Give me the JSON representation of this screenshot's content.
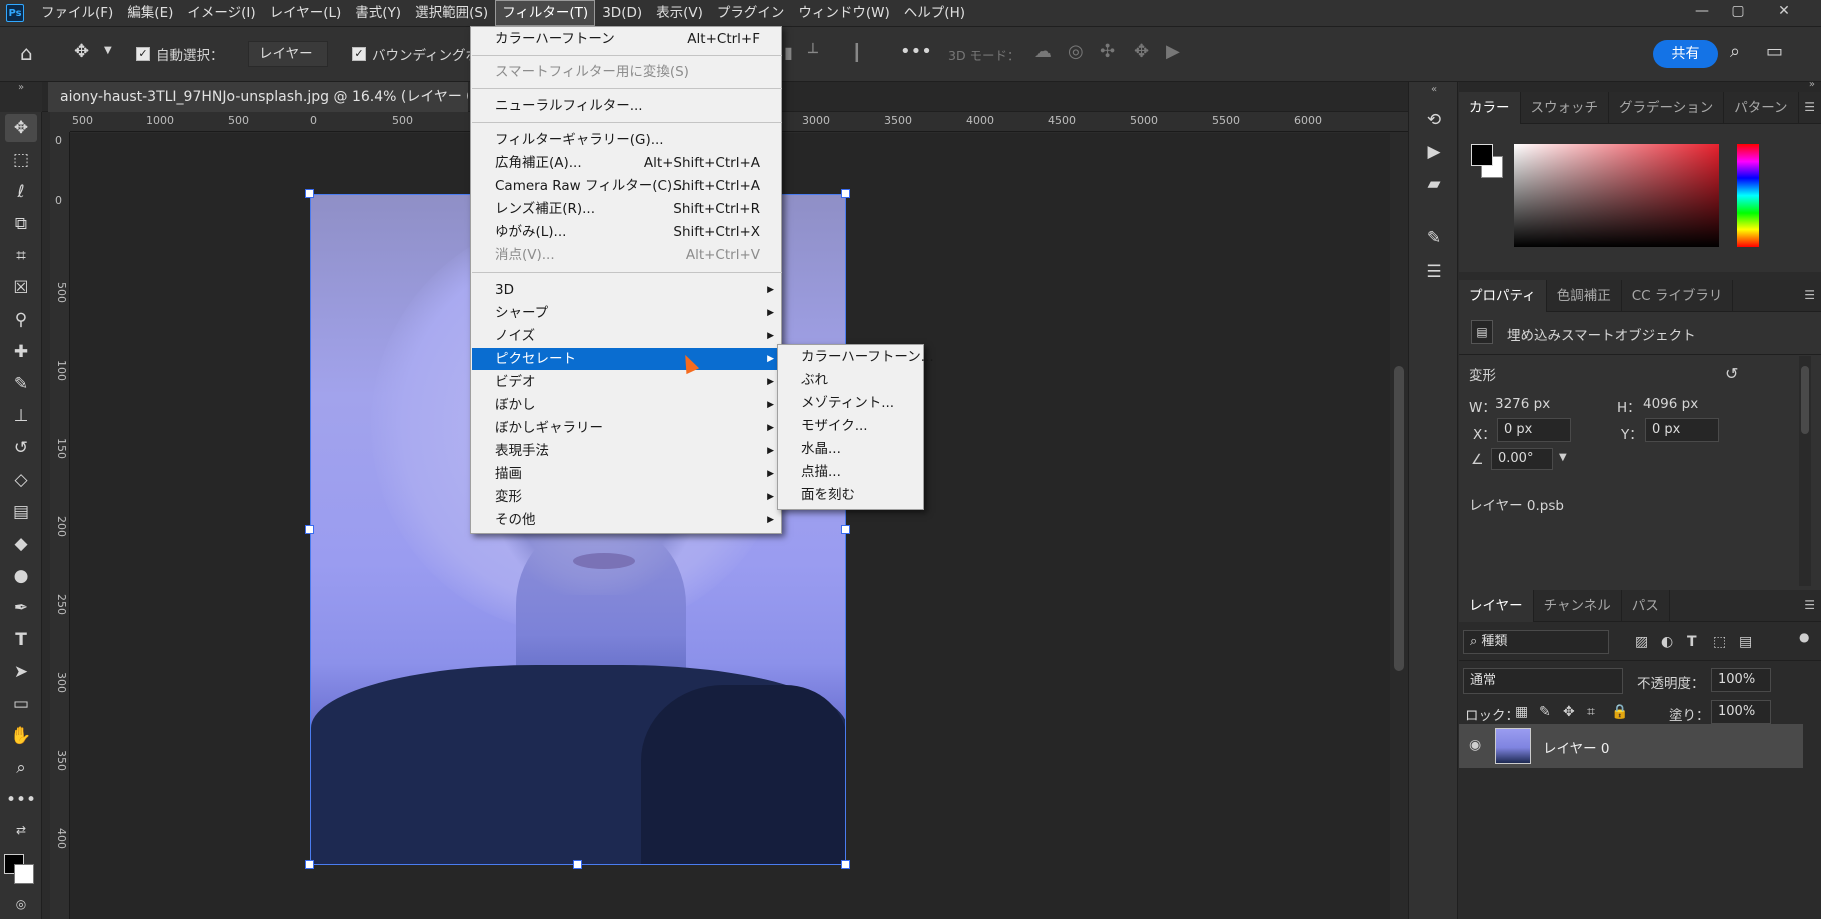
{
  "menubar": {
    "logo": "Ps",
    "items": [
      "ファイル(F)",
      "編集(E)",
      "イメージ(I)",
      "レイヤー(L)",
      "書式(Y)",
      "選択範囲(S)",
      "フィルター(T)",
      "3D(D)",
      "表示(V)",
      "プラグイン",
      "ウィンドウ(W)",
      "ヘルプ(H)"
    ],
    "active_index": 6
  },
  "window_controls": {
    "minimize": "—",
    "maximize": "▢",
    "close": "✕"
  },
  "options": {
    "auto_select_label": "自動選択：",
    "auto_select_value": "レイヤー",
    "bounding_box_label": "バウンディングボ",
    "mode_3d_label": "3D モード：",
    "share_label": "共有"
  },
  "document": {
    "tab_title": "aiony-haust-3TLI_97HNJo-unsplash.jpg @ 16.4% (レイヤー 0, RG",
    "ruler_h_ticks": [
      "500",
      "1000",
      "500",
      "0",
      "500",
      "3000",
      "3500",
      "4000",
      "4500",
      "5000",
      "5500",
      "6000"
    ],
    "ruler_v_ticks": [
      "0",
      "0",
      "500",
      "100",
      "150",
      "200",
      "250",
      "300",
      "350",
      "400"
    ]
  },
  "filter_menu": {
    "items": [
      {
        "label": "カラーハーフトーン",
        "shortcut": "Alt+Ctrl+F",
        "disabled": false
      },
      {
        "label": "スマートフィルター用に変換(S)",
        "shortcut": "",
        "disabled": true
      },
      {
        "label": "ニューラルフィルター...",
        "shortcut": "",
        "disabled": false
      },
      {
        "label": "フィルターギャラリー(G)...",
        "shortcut": "",
        "disabled": false
      },
      {
        "label": "広角補正(A)...",
        "shortcut": "Alt+Shift+Ctrl+A",
        "disabled": false
      },
      {
        "label": "Camera Raw フィルター(C)...",
        "shortcut": "Shift+Ctrl+A",
        "disabled": false
      },
      {
        "label": "レンズ補正(R)...",
        "shortcut": "Shift+Ctrl+R",
        "disabled": false
      },
      {
        "label": "ゆがみ(L)...",
        "shortcut": "Shift+Ctrl+X",
        "disabled": false
      },
      {
        "label": "消点(V)...",
        "shortcut": "Alt+Ctrl+V",
        "disabled": true
      },
      {
        "label": "3D",
        "shortcut": "",
        "disabled": false
      },
      {
        "label": "シャープ",
        "shortcut": "",
        "disabled": false
      },
      {
        "label": "ノイズ",
        "shortcut": "",
        "disabled": false
      },
      {
        "label": "ピクセレート",
        "shortcut": "",
        "disabled": false
      },
      {
        "label": "ビデオ",
        "shortcut": "",
        "disabled": false
      },
      {
        "label": "ぼかし",
        "shortcut": "",
        "disabled": false
      },
      {
        "label": "ぼかしギャラリー",
        "shortcut": "",
        "disabled": false
      },
      {
        "label": "表現手法",
        "shortcut": "",
        "disabled": false
      },
      {
        "label": "描画",
        "shortcut": "",
        "disabled": false
      },
      {
        "label": "変形",
        "shortcut": "",
        "disabled": false
      },
      {
        "label": "その他",
        "shortcut": "",
        "disabled": false
      }
    ],
    "highlighted_index": 12
  },
  "pixelate_submenu": {
    "items": [
      "カラーハーフトーン...",
      "ぶれ",
      "メゾティント...",
      "モザイク...",
      "水晶...",
      "点描...",
      "面を刻む"
    ]
  },
  "color_panel": {
    "tabs": [
      "カラー",
      "スウォッチ",
      "グラデーション",
      "パターン"
    ],
    "active_tab": 0,
    "foreground": "#000000",
    "background": "#ffffff"
  },
  "properties_panel": {
    "tabs": [
      "プロパティ",
      "色調補正",
      "CC ライブラリ"
    ],
    "active_tab": 0,
    "object_type": "埋め込みスマートオブジェクト",
    "section_transform": "変形",
    "w_label": "W：",
    "w_value": "3276 px",
    "h_label": "H：",
    "h_value": "4096 px",
    "x_label": "X：",
    "x_value": "0 px",
    "y_label": "Y：",
    "y_value": "0 px",
    "angle_value": "0.00°",
    "linked_file": "レイヤー 0.psb"
  },
  "layers_panel": {
    "tabs": [
      "レイヤー",
      "チャンネル",
      "パス"
    ],
    "active_tab": 0,
    "filter_kind": "種類",
    "blend_mode": "通常",
    "opacity_label": "不透明度：",
    "opacity_value": "100%",
    "lock_label": "ロック：",
    "fill_label": "塗り：",
    "fill_value": "100%",
    "layers": [
      {
        "name": "レイヤー 0",
        "visible": true
      }
    ]
  }
}
